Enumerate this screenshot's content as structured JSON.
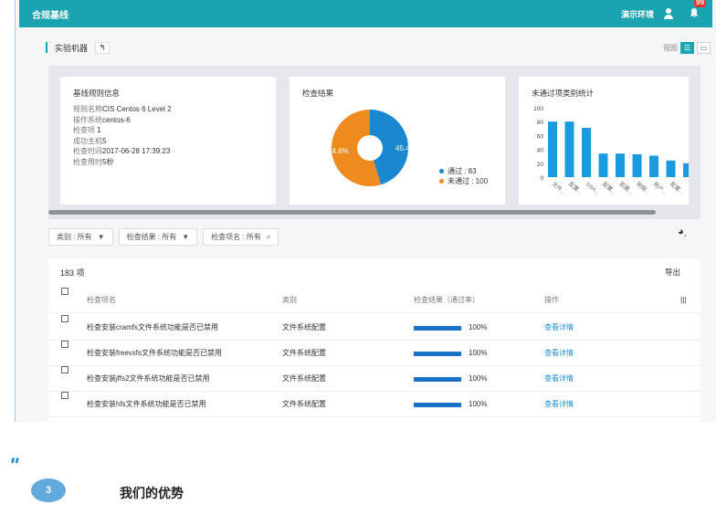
{
  "topbar": {
    "brand": "合规基线",
    "env": "演示环境",
    "badge": "99"
  },
  "subbar": {
    "crumb": "实验机器",
    "up": "↰",
    "view_label": "视图"
  },
  "cards": {
    "info": {
      "title": "基线规则信息",
      "rows": [
        {
          "k": "规则名称",
          "v": "CIS Centos 6 Level 2"
        },
        {
          "k": "操作系统",
          "v": "centos-6"
        },
        {
          "k": "检查项",
          "v": "  1"
        },
        {
          "k": "成功主机",
          "v": "5"
        },
        {
          "k": "检查时间",
          "v": "2017-06-28 17:39:23"
        },
        {
          "k": "检查用时",
          "v": "5秒"
        }
      ]
    },
    "pie": {
      "title": "检查结果",
      "pass_label": "通过 : 83",
      "fail_label": "未通过 : 100",
      "pass_pct": "45.4%",
      "fail_pct": "54.6%",
      "pass_color": "#1a87d1",
      "fail_color": "#ef8a1e"
    },
    "bar": {
      "title": "未通过项类别统计"
    }
  },
  "chart_data": [
    {
      "type": "pie",
      "title": "检查结果",
      "series": [
        {
          "name": "通过",
          "value": 83
        },
        {
          "name": "未通过",
          "value": 100
        }
      ]
    },
    {
      "type": "bar",
      "title": "未通过项类别统计",
      "categories": [
        "文件...",
        "配置...",
        "SSH...",
        "配置...",
        "配置...",
        "网络...",
        "用户...",
        "配置..."
      ],
      "values": [
        80,
        80,
        71,
        34,
        34,
        33,
        31,
        24,
        20
      ],
      "ylim": [
        0,
        100
      ],
      "yticks": [
        0,
        20,
        40,
        60,
        80,
        100
      ],
      "color": "#1a9be0"
    }
  ],
  "filters": [
    {
      "label": "类别 : 所有",
      "icon": "filter-icon"
    },
    {
      "label": "检查结果 : 所有",
      "icon": "filter-icon"
    },
    {
      "label": "检查项名 : 所有",
      "icon": "search-icon"
    }
  ],
  "table": {
    "count": "183 项",
    "export": "导出",
    "headers": {
      "name": "检查项名",
      "type": "类别",
      "result": "检查结果（通过率）",
      "op": "操作",
      "more": "|||"
    },
    "rows": [
      {
        "name": "检查安装cramfs文件系统功能是否已禁用",
        "type": "文件系统配置",
        "pct": "100%",
        "op": "查看详情"
      },
      {
        "name": "检查安装freevxfs文件系统功能是否已禁用",
        "type": "文件系统配置",
        "pct": "100%",
        "op": "查看详情"
      },
      {
        "name": "检查安装jffs2文件系统功能是否已禁用",
        "type": "文件系统配置",
        "pct": "100%",
        "op": "查看详情"
      },
      {
        "name": "检查安装hfs文件系统功能是否已禁用",
        "type": "文件系统配置",
        "pct": "100%",
        "op": "查看详情"
      }
    ]
  },
  "section": {
    "number": "3",
    "title": "我们的优势"
  }
}
